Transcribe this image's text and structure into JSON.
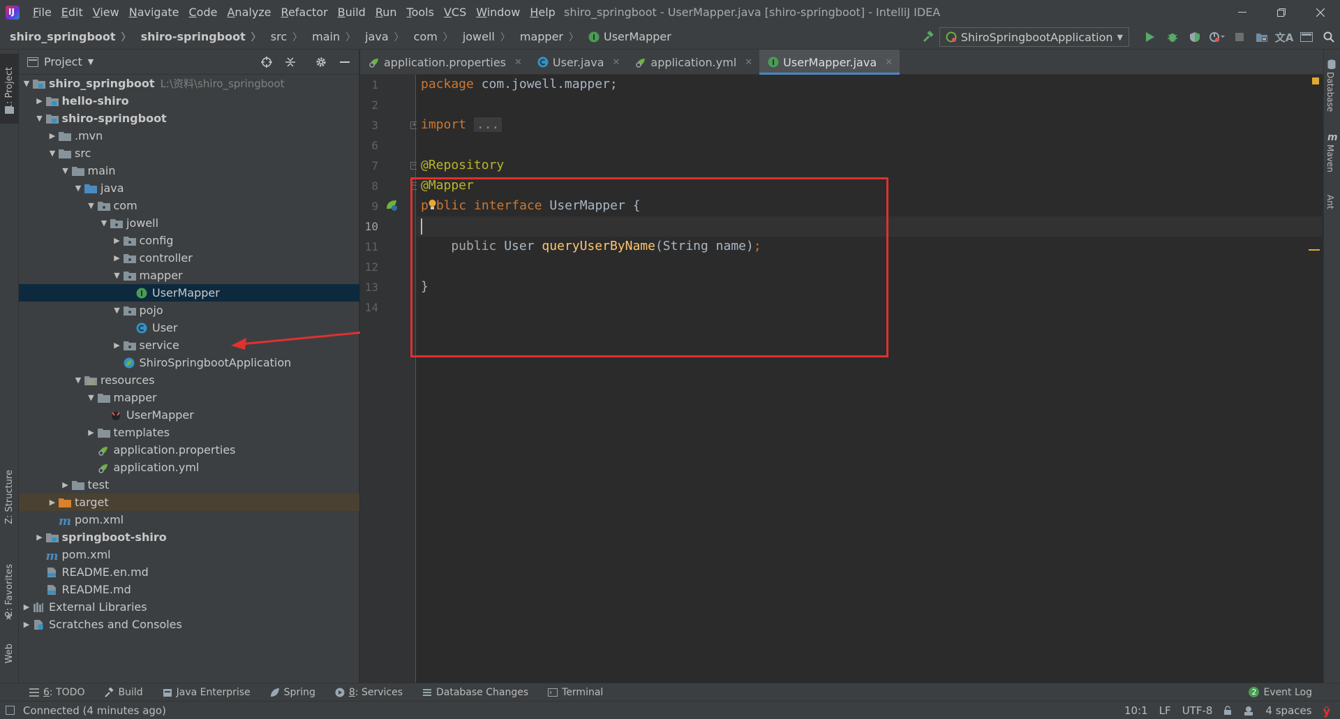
{
  "window": {
    "title": "shiro_springboot - UserMapper.java [shiro-springboot] - IntelliJ IDEA",
    "logo_text": "IJ"
  },
  "menu": [
    "File",
    "Edit",
    "View",
    "Navigate",
    "Code",
    "Analyze",
    "Refactor",
    "Build",
    "Run",
    "Tools",
    "VCS",
    "Window",
    "Help"
  ],
  "breadcrumbs": [
    "shiro_springboot",
    "shiro-springboot",
    "src",
    "main",
    "java",
    "com",
    "jowell",
    "mapper",
    "UserMapper"
  ],
  "run_config": "ShiroSpringbootApplication",
  "left_stripe": {
    "project": "1: Project",
    "structure": "Z: Structure",
    "favorites": "2: Favorites",
    "web": "Web"
  },
  "right_stripe": {
    "database": "Database",
    "maven": "Maven",
    "ant": "Ant"
  },
  "project_panel": {
    "title": "Project",
    "tree": [
      {
        "label": "shiro_springboot",
        "path": "L:\\资料\\shiro_springboot",
        "bold": true
      },
      {
        "label": "hello-shiro",
        "bold": true
      },
      {
        "label": "shiro-springboot",
        "bold": true
      },
      {
        "label": ".mvn"
      },
      {
        "label": "src"
      },
      {
        "label": "main"
      },
      {
        "label": "java"
      },
      {
        "label": "com"
      },
      {
        "label": "jowell"
      },
      {
        "label": "config"
      },
      {
        "label": "controller"
      },
      {
        "label": "mapper"
      },
      {
        "label": "UserMapper"
      },
      {
        "label": "pojo"
      },
      {
        "label": "User"
      },
      {
        "label": "service"
      },
      {
        "label": "ShiroSpringbootApplication"
      },
      {
        "label": "resources"
      },
      {
        "label": "mapper"
      },
      {
        "label": "UserMapper"
      },
      {
        "label": "templates"
      },
      {
        "label": "application.properties"
      },
      {
        "label": "application.yml"
      },
      {
        "label": "test"
      },
      {
        "label": "target"
      },
      {
        "label": "pom.xml"
      },
      {
        "label": "springboot-shiro",
        "bold": true
      },
      {
        "label": "pom.xml"
      },
      {
        "label": "README.en.md"
      },
      {
        "label": "README.md"
      },
      {
        "label": "External Libraries"
      },
      {
        "label": "Scratches and Consoles"
      }
    ]
  },
  "tabs": [
    {
      "label": "application.properties"
    },
    {
      "label": "User.java"
    },
    {
      "label": "application.yml"
    },
    {
      "label": "UserMapper.java",
      "active": true
    }
  ],
  "editor": {
    "line_numbers": [
      "1",
      "2",
      "3",
      "6",
      "7",
      "8",
      "9",
      "10",
      "11",
      "12",
      "13",
      "14"
    ],
    "lines": {
      "l1_kw": "package",
      "l1_rest": " com.jowell.mapper;",
      "l3_kw": "import",
      "l3_fold": "...",
      "l7": "@Repository",
      "l8": "@Mapper",
      "l9_a": "p",
      "l9_b": "blic",
      "l9_kw2": "interface",
      "l9_rest": " UserMapper {",
      "l11_a": "    public ",
      "l11_b": "User ",
      "l11_fn": "queryUserByName",
      "l11_rest": "(String name)",
      "l11_semi": ";",
      "l13": "}"
    }
  },
  "bottom_tools": [
    {
      "num": "6",
      "label": ": TODO"
    },
    {
      "label": "Build"
    },
    {
      "label": "Java Enterprise"
    },
    {
      "label": "Spring"
    },
    {
      "num": "8",
      "label": ": Services"
    },
    {
      "label": "Database Changes"
    },
    {
      "label": "Terminal"
    }
  ],
  "event_log": {
    "count": "2",
    "label": "Event Log"
  },
  "status": {
    "message": "Connected (4 minutes ago)",
    "position": "10:1",
    "line_sep": "LF",
    "encoding": "UTF-8",
    "indent": "4 spaces"
  },
  "colors": {
    "keyword": "#cc7832",
    "annotation": "#bbb529",
    "method": "#ffc66d",
    "selection": "#0d293e",
    "highlight_box": "#e0312f",
    "arrow": "#e0312f"
  }
}
